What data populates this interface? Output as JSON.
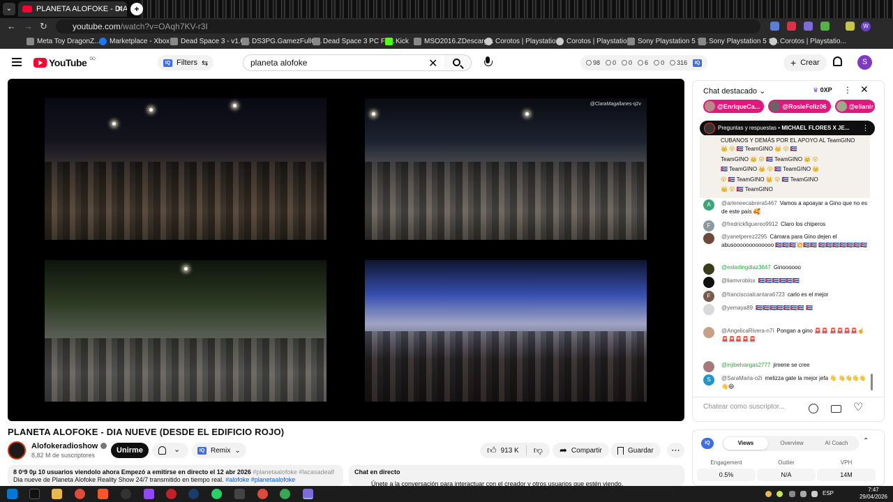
{
  "browser": {
    "tab_title": "PLANETA ALOFOKE - DIA N",
    "url_host": "youtube.com",
    "url_path": "/watch?v=OAqh7KV-r3I",
    "bookmarks": [
      "Meta Toy DragonZ...",
      "Marketplace - Xbox...",
      "Dead Space 3 - v1.0...",
      "DS3PG.GamezFullC...",
      "Dead Space 3 PC Fu...",
      "Kick",
      "MSO2016.ZDescarg...",
      "Corotos | Playstatio...",
      "Corotos | Playstatio...",
      "Sony Playstation 5 S...",
      "Sony Playstation 5 S...",
      "Corotos | Playstatio..."
    ],
    "profile_initial": "W"
  },
  "header": {
    "logo_text": "YouTube",
    "logo_country": "DO",
    "filters_label": "Filters",
    "search_value": "planeta alofoke",
    "stats": [
      "98",
      "0",
      "0",
      "6",
      "0",
      "316"
    ],
    "create_label": "Crear",
    "avatar_initial": "S"
  },
  "video": {
    "title": "PLANETA ALOFOKE - DIA NUEVE (DESDE EL EDIFICIO ROJO)",
    "watermark": "@ClaraMagallanes-q2v"
  },
  "channel": {
    "name": "Alofokeradioshow",
    "subscribers": "8,82 M de suscriptores",
    "join_label": "Unirme",
    "remix_label": "Remix"
  },
  "actions": {
    "likes": "913 K",
    "share": "Compartir",
    "save": "Guardar"
  },
  "description": {
    "line1_count": "8 0¹9 0µ 10",
    "line1_text": "usuarios viendolo ahora  Empezó a emitirse en directo el 12 abr 2026",
    "line1_tags": "#planetaalofoke #lacasadealf",
    "line2_text": "Dia nueve de Planeta Alofoke Reality Show 24/7 transmitido en tiempo real.",
    "line2_tags": "#alofoke #planetaalofoke"
  },
  "chat_below": {
    "title": "Chat en directo",
    "hint": "Únete a la conversación para interactuar con el creador y otros usuarios que estén viendo."
  },
  "chat": {
    "header": "Chat destacado",
    "xp": "0XP",
    "chips": [
      "@EnriqueCa...",
      "@RosieFeliz06",
      "@elianir"
    ],
    "pinned_prefix": "Preguntas y respuestas •",
    "pinned_title": "MICHAEL FLORES X JE...",
    "pinned_text": "CUBANOS Y DEMÁS POR EL APOYO AL TeamGINO",
    "pinned_repeat": "TeamGINO",
    "messages": [
      {
        "user": "@arleneecabrera5467",
        "text": "Vamos a apoayar a Gino que no es de este país 🥰",
        "initial": "A",
        "color": "#3ba57a"
      },
      {
        "user": "@fredrickfiguereo9912",
        "text": "Claro los chiperos",
        "initial": "F",
        "color": "#8a9ba0"
      },
      {
        "user": "@yanetperez2295",
        "text": "Cámara para Gino dejen el abusooooooooooooo 🇨🇺🇨🇺🇨🇺💥🇨🇺🇨🇺 🇨🇺🇨🇺🇨🇺🇨🇺🇨🇺🇨🇺🇨🇺",
        "initial": "",
        "color": "#6b4a3a"
      },
      {
        "user": "@estarlingdiaz3647",
        "text": "Ginoooooo",
        "initial": "",
        "color": "#3b3b1d",
        "green": true
      },
      {
        "user": "@liamvroblox",
        "text": "🇨🇺🇨🇺🇨🇺🇨🇺🇨🇺🇨🇺",
        "initial": "",
        "color": "#111111"
      },
      {
        "user": "@franciscoalcantara6723",
        "text": "carlo es el mejor",
        "initial": "F",
        "color": "#7a5a4a"
      },
      {
        "user": "@yemaya89",
        "text": "🇨🇺🇨🇺🇨🇺🇨🇺🇨🇺🇨🇺🇨🇺 🇨🇺",
        "initial": "",
        "color": "#d9d9d9"
      },
      {
        "user": "@AngelicaRivera-n7i",
        "text": "Pongan a gino 🚨🚨 🚨🚨🚨🚨☝️🚨🚨🚨🚨🚨",
        "initial": "",
        "color": "#c7a08a"
      },
      {
        "user": "@injibelvargas2777",
        "text": "jimene se cree",
        "initial": "",
        "color": "#a77a7a",
        "green": true
      },
      {
        "user": "@SaraMaria-o2i",
        "text": "melizza gate la mejor jefa 👋 👋👋👋👋👋😄",
        "initial": "S",
        "color": "#2196c9"
      }
    ],
    "input_placeholder": "Chatear como suscriptor..."
  },
  "analytics": {
    "tabs": [
      "Views",
      "Overview",
      "AI Coach"
    ],
    "cols": [
      {
        "label": "Engagement",
        "value": "0.5%"
      },
      {
        "label": "Outlier",
        "value": "N/A"
      },
      {
        "label": "VPH",
        "value": "14M"
      }
    ]
  },
  "taskbar": {
    "lang": "ESP",
    "time": "7:47",
    "date": "29/04/2026"
  }
}
